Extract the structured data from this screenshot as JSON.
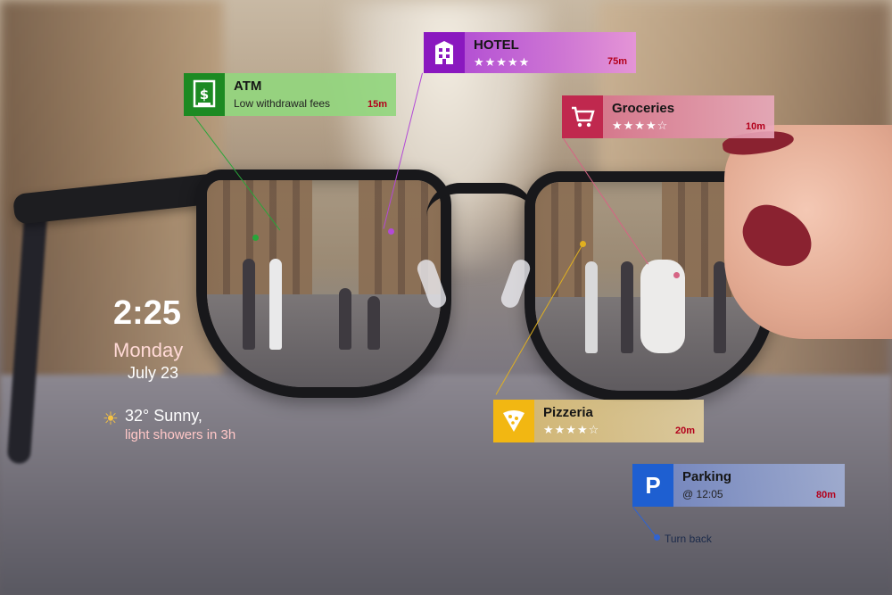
{
  "hud": {
    "atm": {
      "title": "ATM",
      "subtitle": "Low withdrawal fees",
      "distance": "15m",
      "icon": "dollar-icon",
      "color": "#1c8a22"
    },
    "hotel": {
      "title": "HOTEL",
      "stars": "★★★★★",
      "rating": 5,
      "distance": "75m",
      "icon": "building-icon",
      "color": "#8a18bf"
    },
    "groceries": {
      "title": "Groceries",
      "stars": "★★★★☆",
      "rating": 4,
      "distance": "10m",
      "icon": "cart-icon",
      "color": "#c0284e"
    },
    "pizzeria": {
      "title": "Pizzeria",
      "stars": "★★★★☆",
      "rating": 4,
      "distance": "20m",
      "icon": "pizza-icon",
      "color": "#f2b712"
    },
    "parking": {
      "title": "Parking",
      "subtitle": "@ 12:05",
      "distance": "80m",
      "icon": "parking-icon",
      "icon_letter": "P",
      "color": "#1e5fd1",
      "note": "Turn back"
    }
  },
  "clock": {
    "time": "2:25",
    "day": "Monday",
    "date": "July 23"
  },
  "weather": {
    "icon": "sun-icon",
    "condition": "32° Sunny,",
    "forecast": "light showers in 3h"
  }
}
